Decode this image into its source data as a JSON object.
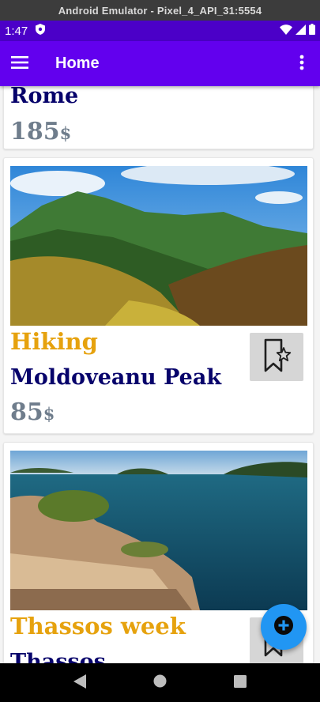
{
  "emulator": {
    "title": "Android Emulator - Pixel_4_API_31:5554"
  },
  "status_bar": {
    "time": "1:47"
  },
  "app_bar": {
    "title": "Home"
  },
  "cards": [
    {
      "category": "",
      "place": "Rome",
      "price": "185",
      "currency": "$"
    },
    {
      "category": "Hiking",
      "place": "Moldoveanu Peak",
      "price": "85",
      "currency": "$"
    },
    {
      "category": "Thassos week",
      "place": "Thassos",
      "price": "",
      "currency": ""
    }
  ],
  "colors": {
    "app_bar": "#6200ee",
    "status_bar": "#4b00c8",
    "category_text": "#e6a20e",
    "place_text": "#07036b",
    "price_text": "#6f7d8c",
    "fab": "#2196f3"
  },
  "icons": [
    "menu-icon",
    "more-vert-icon",
    "bookmark-star-icon",
    "add-circle-icon",
    "back-icon",
    "home-icon",
    "recents-icon"
  ]
}
